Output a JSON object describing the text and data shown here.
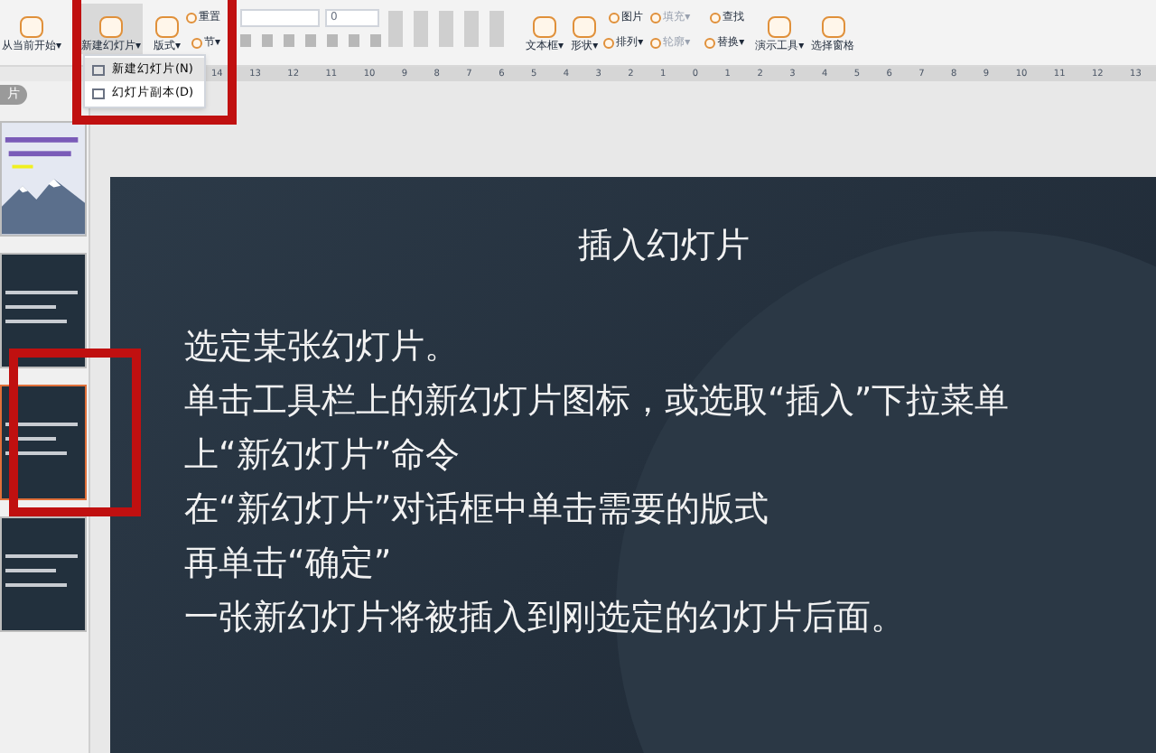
{
  "toolbar": {
    "groups": [
      {
        "kind": "big",
        "label": "从当前开始▾"
      },
      {
        "kind": "big",
        "label": "新建幻灯片▾",
        "selected": true
      },
      {
        "kind": "pair",
        "items": [
          {
            "label": "版式▾",
            "kind": "large"
          },
          {
            "label": "重置",
            "kind": "small"
          },
          {
            "label": "节▾",
            "kind": "small"
          }
        ]
      },
      {
        "kind": "font",
        "size": "0"
      },
      {
        "kind": "format"
      },
      {
        "kind": "pair",
        "items": [
          {
            "label": "文本框▾",
            "kind": "large"
          },
          {
            "label": "形状▾",
            "kind": "large"
          },
          {
            "label": "图片",
            "kind": "small",
            "disabled": false
          },
          {
            "label": "排列▾",
            "kind": "small",
            "disabled": false
          },
          {
            "label": "填充▾",
            "kind": "small",
            "disabled": true
          },
          {
            "label": "轮廓▾",
            "kind": "small",
            "disabled": true
          }
        ]
      },
      {
        "kind": "pair",
        "items": [
          {
            "label": "查找",
            "kind": "small"
          },
          {
            "label": "替换▾",
            "kind": "small"
          }
        ]
      },
      {
        "kind": "big",
        "label": "演示工具▾"
      },
      {
        "kind": "big",
        "label": "选择窗格"
      }
    ]
  },
  "dropdown": {
    "items": [
      {
        "label": "新建幻灯片(N)",
        "selected": true
      },
      {
        "label": "幻灯片副本(D)",
        "selected": false
      }
    ]
  },
  "ruler": {
    "labels": [
      "14",
      "13",
      "12",
      "11",
      "10",
      "9",
      "8",
      "7",
      "6",
      "5",
      "4",
      "3",
      "2",
      "1",
      "0",
      "1",
      "2",
      "3",
      "4",
      "5",
      "6",
      "7",
      "8",
      "9",
      "10",
      "11",
      "12",
      "13"
    ]
  },
  "sidebar": {
    "tab": "片",
    "thumbnails": [
      {
        "kind": "picture",
        "selected": false
      },
      {
        "kind": "text",
        "selected": false
      },
      {
        "kind": "text",
        "selected": true
      },
      {
        "kind": "text",
        "selected": false
      }
    ]
  },
  "slide": {
    "title": "插入幻灯片",
    "lines": [
      "选定某张幻灯片。",
      "单击工具栏上的新幻灯片图标，或选取“插入”下拉菜单",
      "上“新幻灯片”命令",
      "在“新幻灯片”对话框中单击需要的版式",
      "再单击“确定”",
      "一张新幻灯片将被插入到刚选定的幻灯片后面。"
    ]
  }
}
